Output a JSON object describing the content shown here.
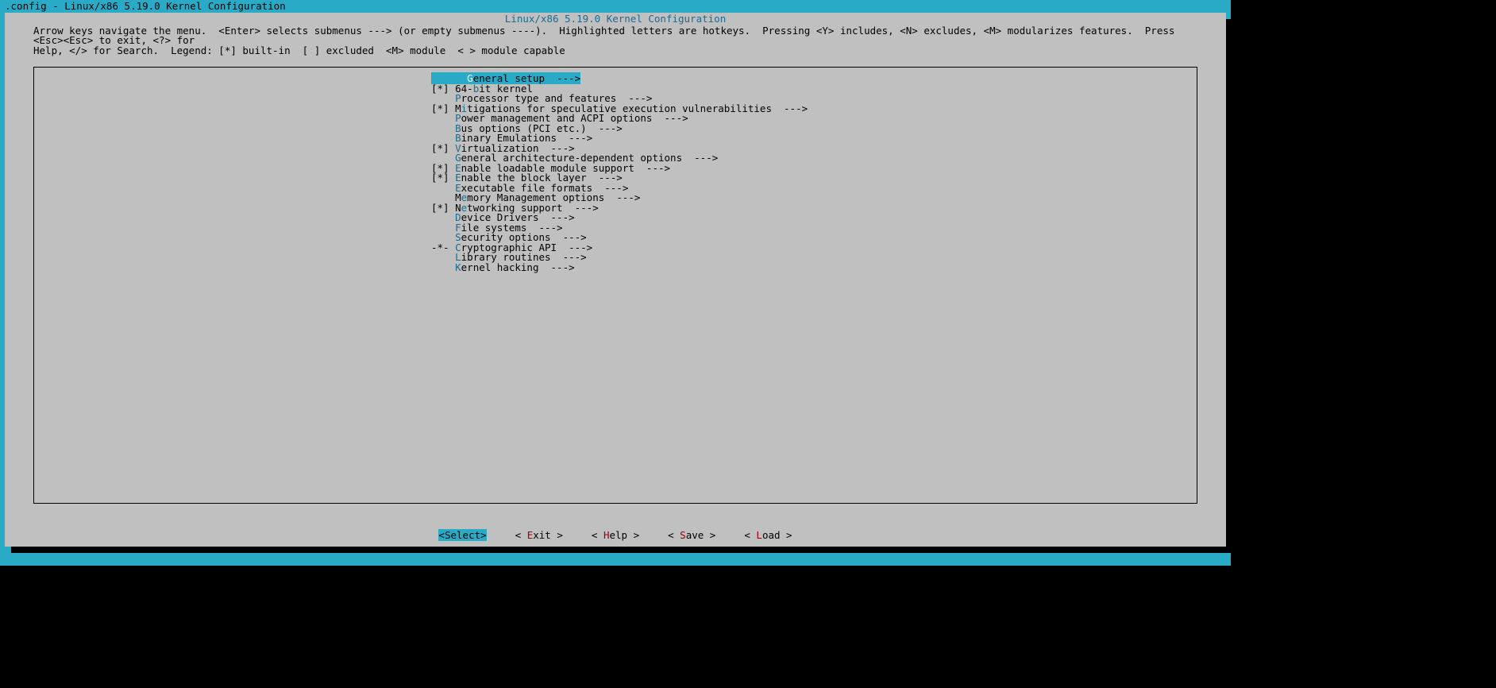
{
  "colors": {
    "accent": "#29abc7",
    "bg_gray": "#c0c0c0",
    "hot_blue": "#1a6b8e",
    "red": "#a00000"
  },
  "title_bar": ".config - Linux/x86 5.19.0 Kernel Configuration",
  "dialog_title": "Linux/x86 5.19.0 Kernel Configuration",
  "help_line1": "Arrow keys navigate the menu.  <Enter> selects submenus ---> (or empty submenus ----).  Highlighted letters are hotkeys.  Pressing <Y> includes, <N> excludes, <M> modularizes features.  Press <Esc><Esc> to exit, <?> for",
  "help_line2": "Help, </> for Search.  Legend: [*] built-in  [ ] excluded  <M> module  < > module capable",
  "menu": [
    {
      "bracket": "   ",
      "pre": "   ",
      "hot": "G",
      "post": "eneral setup  --->",
      "selected": true
    },
    {
      "bracket": "[*]",
      "pre": " 64-",
      "hot": "b",
      "post": "it kernel",
      "selected": false
    },
    {
      "bracket": "   ",
      "pre": " ",
      "hot": "P",
      "post": "rocessor type and features  --->",
      "selected": false
    },
    {
      "bracket": "[*]",
      "pre": " M",
      "hot": "i",
      "post": "tigations for speculative execution vulnerabilities  --->",
      "selected": false
    },
    {
      "bracket": "   ",
      "pre": " ",
      "hot": "P",
      "post": "ower management and ACPI options  --->",
      "selected": false
    },
    {
      "bracket": "   ",
      "pre": " ",
      "hot": "B",
      "post": "us options (PCI etc.)  --->",
      "selected": false
    },
    {
      "bracket": "   ",
      "pre": " ",
      "hot": "B",
      "post": "inary Emulations  --->",
      "selected": false
    },
    {
      "bracket": "[*]",
      "pre": " ",
      "hot": "V",
      "post": "irtualization  --->",
      "selected": false
    },
    {
      "bracket": "   ",
      "pre": " ",
      "hot": "G",
      "post": "eneral architecture-dependent options  --->",
      "selected": false
    },
    {
      "bracket": "[*]",
      "pre": " ",
      "hot": "E",
      "post": "nable loadable module support  --->",
      "selected": false
    },
    {
      "bracket": "[*]",
      "pre": " ",
      "hot": "E",
      "post": "nable the block layer  --->",
      "selected": false
    },
    {
      "bracket": "   ",
      "pre": " ",
      "hot": "E",
      "post": "xecutable file formats  --->",
      "selected": false
    },
    {
      "bracket": "   ",
      "pre": " M",
      "hot": "e",
      "post": "mory Management options  --->",
      "selected": false
    },
    {
      "bracket": "[*]",
      "pre": " N",
      "hot": "e",
      "post": "tworking support  --->",
      "selected": false
    },
    {
      "bracket": "   ",
      "pre": " ",
      "hot": "D",
      "post": "evice Drivers  --->",
      "selected": false
    },
    {
      "bracket": "   ",
      "pre": " ",
      "hot": "F",
      "post": "ile systems  --->",
      "selected": false
    },
    {
      "bracket": "   ",
      "pre": " ",
      "hot": "S",
      "post": "ecurity options  --->",
      "selected": false
    },
    {
      "bracket": "-*-",
      "pre": " ",
      "hot": "C",
      "post": "ryptographic API  --->",
      "selected": false
    },
    {
      "bracket": "   ",
      "pre": " ",
      "hot": "L",
      "post": "ibrary routines  --->",
      "selected": false
    },
    {
      "bracket": "   ",
      "pre": " ",
      "hot": "K",
      "post": "ernel hacking  --->",
      "selected": false
    }
  ],
  "buttons": [
    {
      "label": "<Select>",
      "hot": "S",
      "pre": "<",
      "rest": "elect>",
      "selected": true
    },
    {
      "label": "< Exit >",
      "hot": "E",
      "pre": "< ",
      "rest": "xit >",
      "selected": false
    },
    {
      "label": "< Help >",
      "hot": "H",
      "pre": "< ",
      "rest": "elp >",
      "selected": false
    },
    {
      "label": "< Save >",
      "hot": "S",
      "pre": "< ",
      "rest": "ave >",
      "selected": false
    },
    {
      "label": "< Load >",
      "hot": "L",
      "pre": "< ",
      "rest": "oad >",
      "selected": false
    }
  ]
}
